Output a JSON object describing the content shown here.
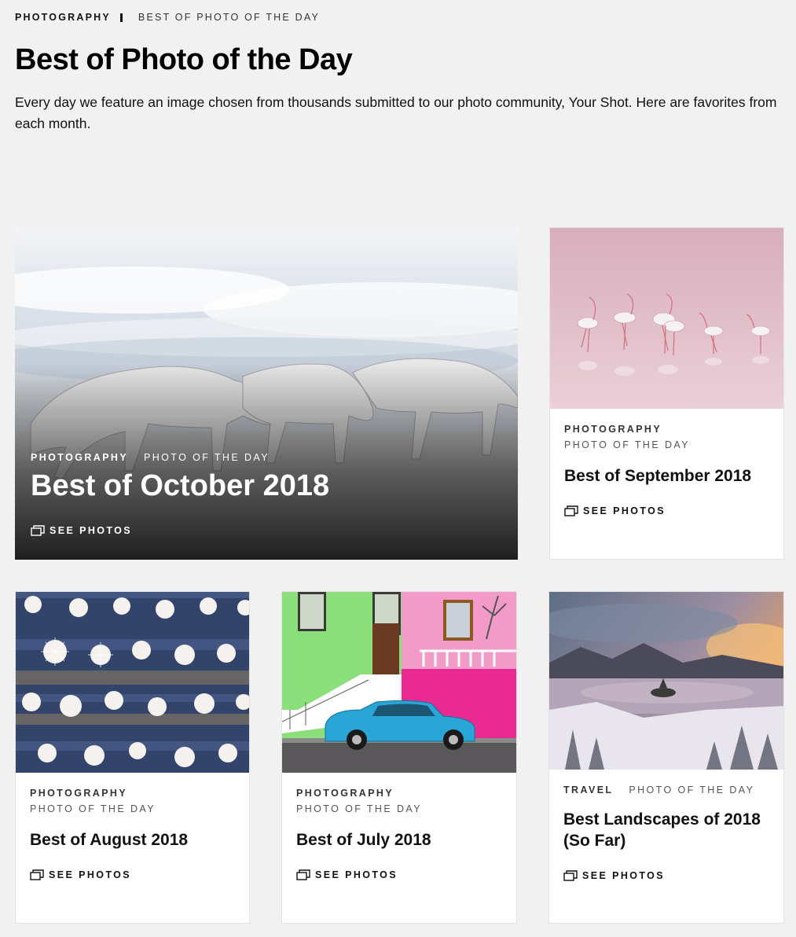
{
  "breadcrumb": {
    "section": "PHOTOGRAPHY",
    "page": "BEST OF PHOTO OF THE DAY"
  },
  "header": {
    "title": "Best of Photo of the Day",
    "intro": "Every day we feature an image chosen from thousands submitted to our photo community, Your Shot. Here are favorites from each month."
  },
  "cards": [
    {
      "category": "PHOTOGRAPHY",
      "series": "PHOTO OF THE DAY",
      "title": "Best of October 2018",
      "cta": "SEE PHOTOS",
      "image": "arctic-wolves-photo"
    },
    {
      "category": "PHOTOGRAPHY",
      "series": "PHOTO OF THE DAY",
      "title": "Best of September 2018",
      "cta": "SEE PHOTOS",
      "image": "flamingos-photo"
    },
    {
      "category": "PHOTOGRAPHY",
      "series": "PHOTO OF THE DAY",
      "title": "Best of August 2018",
      "cta": "SEE PHOTOS",
      "image": "aerial-pattern-photo"
    },
    {
      "category": "PHOTOGRAPHY",
      "series": "PHOTO OF THE DAY",
      "title": "Best of July 2018",
      "cta": "SEE PHOTOS",
      "image": "blue-car-colorful-houses-photo"
    },
    {
      "category": "TRAVEL",
      "series": "PHOTO OF THE DAY",
      "title": "Best Landscapes of 2018 (So Far)",
      "cta": "SEE PHOTOS",
      "image": "snowy-lake-island-photo"
    }
  ],
  "icons": {
    "cta": "gallery-icon"
  },
  "colors": {
    "background": "#f1f1f1",
    "card": "#ffffff",
    "text": "#111111"
  }
}
